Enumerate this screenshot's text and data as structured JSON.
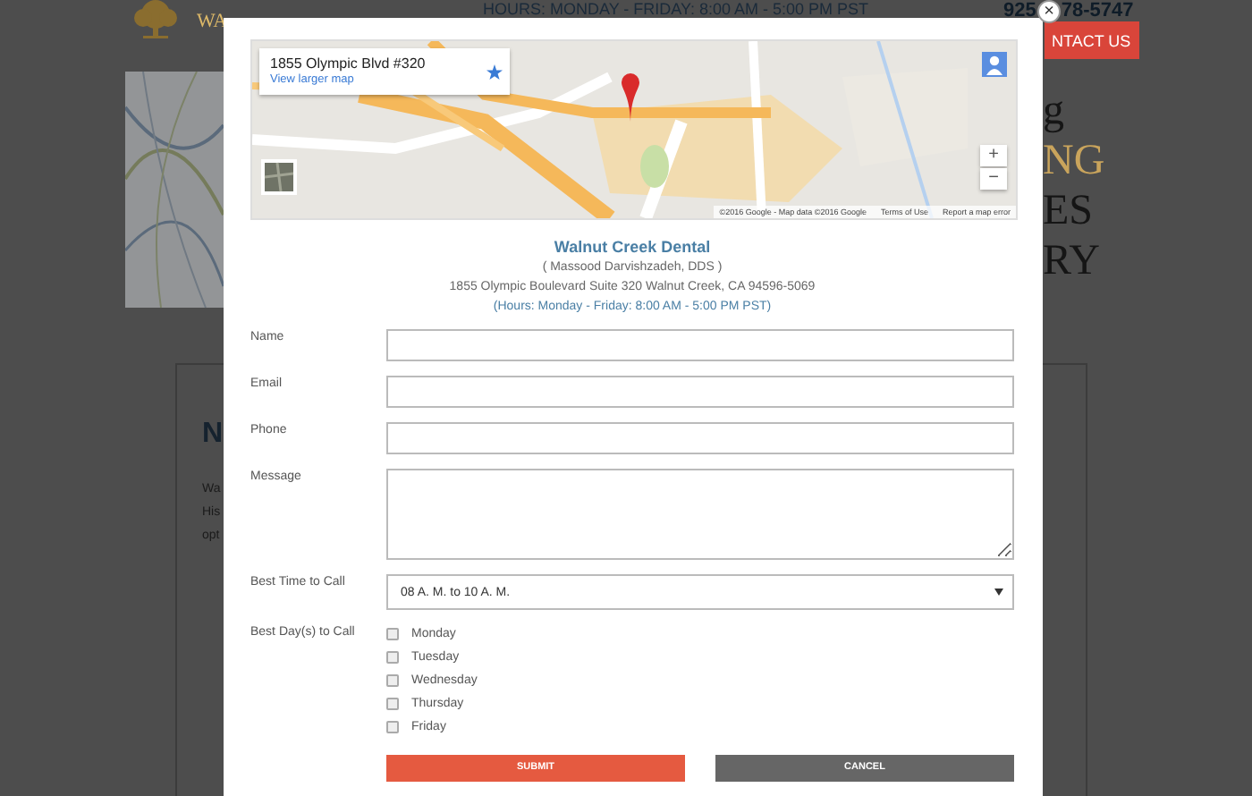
{
  "background": {
    "logo_text": "WA",
    "hours": "HOURS: MONDAY - FRIDAY: 8:00 AM - 5:00 PM PST",
    "phone_parts": [
      "925",
      "78-5747"
    ],
    "contact_button": "NTACT US",
    "hero_fragments": [
      "g",
      "NG",
      "ES",
      "RY"
    ],
    "card": {
      "heading": "N",
      "lines": [
        "Wa",
        "His",
        "opt"
      ]
    }
  },
  "dialog": {
    "close": "×",
    "map": {
      "place": "1855 Olympic Blvd #320",
      "link": "View larger map",
      "zoom_in": "+",
      "zoom_out": "−",
      "attribution": "©2016 Google - Map data ©2016 Google",
      "links": [
        "Terms of Use",
        "Report a map error"
      ]
    },
    "practice": {
      "name": "Walnut Creek Dental",
      "doctor": "( Massood Darvishzadeh, DDS )",
      "address": "1855 Olympic Boulevard Suite 320 Walnut Creek, CA 94596-5069",
      "hours": "(Hours: Monday - Friday: 8:00 AM - 5:00 PM PST)"
    },
    "fields": [
      {
        "label": "Name",
        "kind": "text"
      },
      {
        "label": "Email",
        "kind": "text"
      },
      {
        "label": "Phone",
        "kind": "text"
      },
      {
        "label": "Message",
        "kind": "textarea"
      },
      {
        "label": "Best Time to Call",
        "kind": "select",
        "value": "08 A. M. to 10 A. M."
      }
    ],
    "days": {
      "label": "Best Day(s) to Call",
      "options": [
        {
          "label": "Monday",
          "checked": false
        },
        {
          "label": "Tuesday",
          "checked": false
        },
        {
          "label": "Wednesday",
          "checked": false
        },
        {
          "label": "Thursday",
          "checked": false
        },
        {
          "label": "Friday",
          "checked": false
        }
      ]
    },
    "buttons": [
      {
        "label": "SUBMIT",
        "kind": "primary"
      },
      {
        "label": "CANCEL",
        "kind": "secondary"
      }
    ]
  }
}
